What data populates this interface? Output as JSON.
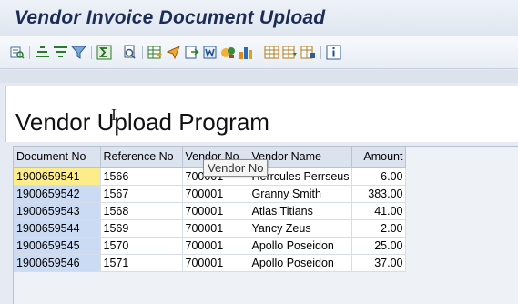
{
  "window": {
    "title": "Vendor Invoice Document Upload"
  },
  "toolbar": {
    "buttons": [
      {
        "icon": "details-icon"
      },
      {
        "icon": "sort-ascending-icon"
      },
      {
        "icon": "sort-descending-icon"
      },
      {
        "icon": "filter-icon"
      },
      {
        "icon": "sum-icon"
      },
      {
        "icon": "print-preview-icon"
      },
      {
        "icon": "export-spreadsheet-icon"
      },
      {
        "icon": "send-icon"
      },
      {
        "icon": "local-file-icon"
      },
      {
        "icon": "word-processing-icon"
      },
      {
        "icon": "abc-analysis-icon"
      },
      {
        "icon": "graphic-icon"
      },
      {
        "icon": "change-layout-icon"
      },
      {
        "icon": "select-layout-icon"
      },
      {
        "icon": "save-layout-icon"
      },
      {
        "icon": "information-icon"
      }
    ]
  },
  "page": {
    "heading": "Vendor Upload Program"
  },
  "table": {
    "columns": [
      "Document No",
      "Reference No",
      "Vendor No",
      "Vendor Name",
      "Amount"
    ],
    "rows": [
      [
        "1900659541",
        "1566",
        "700001",
        "Herrcules Perrseus",
        "6.00"
      ],
      [
        "1900659542",
        "1567",
        "700001",
        "Granny Smith",
        "383.00"
      ],
      [
        "1900659543",
        "1568",
        "700001",
        "Atlas Titians",
        "41.00"
      ],
      [
        "1900659544",
        "1569",
        "700001",
        "Yancy Zeus",
        "2.00"
      ],
      [
        "1900659545",
        "1570",
        "700001",
        "Apollo Poseidon",
        "25.00"
      ],
      [
        "1900659546",
        "1571",
        "700001",
        "Apollo Poseidon",
        "37.00"
      ]
    ],
    "selected_row": 0
  },
  "tooltip": {
    "text": "Vendor No"
  },
  "colors": {
    "title": "#1c2d55",
    "key_column": "#cbdbf4",
    "selected_cell": "#fcec8a",
    "header": "#dbe3ef"
  }
}
